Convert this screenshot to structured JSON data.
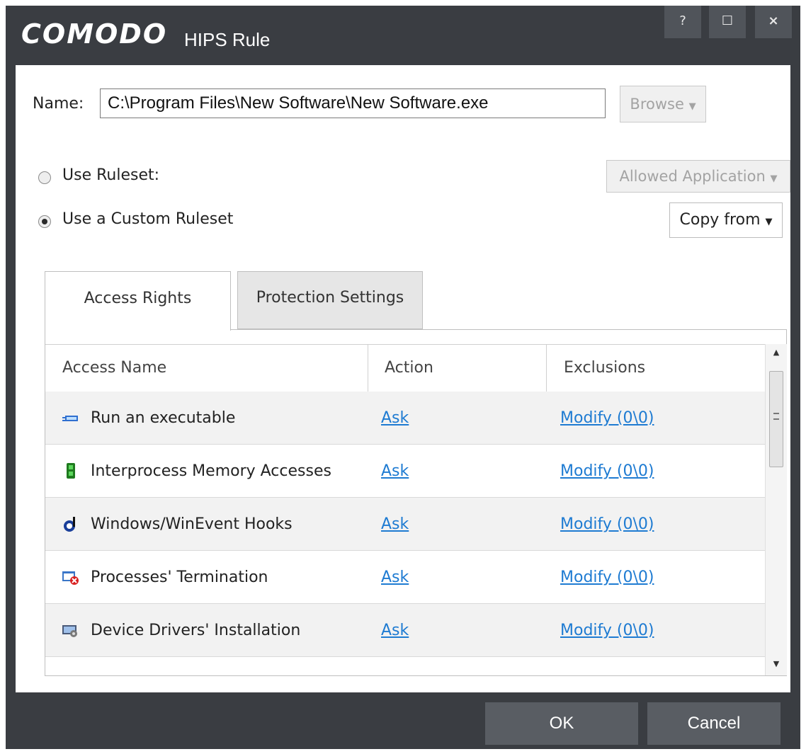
{
  "window": {
    "brand": "COMODO",
    "title": "HIPS Rule",
    "controls": [
      "?",
      "☐",
      "×"
    ]
  },
  "name": {
    "label": "Name:",
    "value": "C:\\Program Files\\New Software\\New Software.exe",
    "browse_label": "Browse"
  },
  "options": {
    "use_ruleset_label": "Use Ruleset:",
    "ruleset_value": "Allowed Application",
    "use_custom_label": "Use a Custom Ruleset",
    "copy_from_label": "Copy from",
    "selected": "custom"
  },
  "tabs": [
    {
      "label": "Access Rights",
      "active": true
    },
    {
      "label": "Protection Settings",
      "active": false
    }
  ],
  "table": {
    "columns": [
      "Access Name",
      "Action",
      "Exclusions"
    ],
    "rows": [
      {
        "icon": "run-executable-icon",
        "name": "Run an executable",
        "action": "Ask",
        "exclusions": "Modify (0\\0)"
      },
      {
        "icon": "memory-icon",
        "name": "Interprocess Memory Accesses",
        "action": "Ask",
        "exclusions": "Modify (0\\0)"
      },
      {
        "icon": "hook-icon",
        "name": "Windows/WinEvent Hooks",
        "action": "Ask",
        "exclusions": "Modify (0\\0)"
      },
      {
        "icon": "process-termination-icon",
        "name": "Processes' Termination",
        "action": "Ask",
        "exclusions": "Modify (0\\0)"
      },
      {
        "icon": "driver-installation-icon",
        "name": "Device Drivers' Installation",
        "action": "Ask",
        "exclusions": "Modify (0\\0)"
      }
    ]
  },
  "footer": {
    "ok_label": "OK",
    "cancel_label": "Cancel"
  },
  "colors": {
    "chrome": "#3a3d42",
    "button": "#595d63",
    "link": "#1e7bd2"
  }
}
